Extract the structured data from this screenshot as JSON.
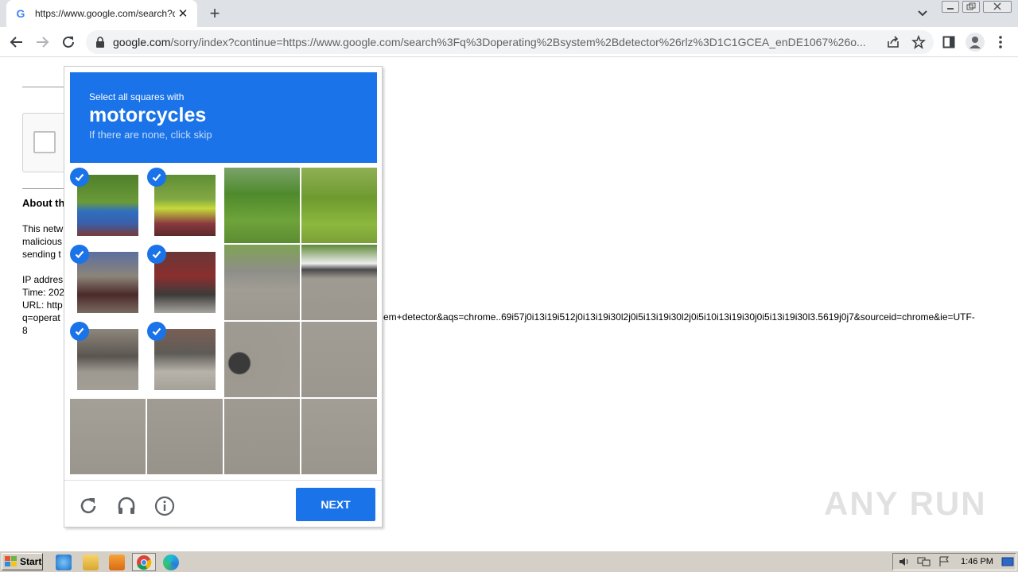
{
  "browser": {
    "tab_title": "https://www.google.com/search?q=",
    "tab_favicon": "G",
    "new_tab": "+",
    "address_host": "google.com",
    "address_path": "/sorry/index?continue=https://www.google.com/search%3Fq%3Doperating%2Bsystem%2Bdetector%26rlz%3D1C1GCEA_enDE1067%26o..."
  },
  "page": {
    "about_heading": "About th",
    "para_lines": [
      "This netw",
      "malicious",
      "sending t"
    ],
    "info_lines": [
      "IP addres",
      "Time: 202",
      "URL: http",
      "q=operat",
      "8"
    ],
    "url_tail": "em+detector&aqs=chrome..69i57j0i13i19i512j0i13i19i30l2j0i5i13i19i30l2j0i5i10i13i19i30j0i5i13i19i30l3.5619j0j7&sourceid=chrome&ie=UTF-",
    "watermark": "ANY RUN"
  },
  "captcha": {
    "instruction_line1": "Select all squares with",
    "instruction_target": "motorcycles",
    "instruction_line3": "If there are none, click skip",
    "next_label": "NEXT",
    "selected_tiles": [
      0,
      1,
      4,
      5,
      8,
      9
    ],
    "footer_icons": [
      "reload-icon",
      "audio-headphones-icon",
      "info-icon"
    ],
    "accent_color": "#1a73e8"
  },
  "taskbar": {
    "start_label": "Start",
    "clock": "1:46 PM"
  }
}
